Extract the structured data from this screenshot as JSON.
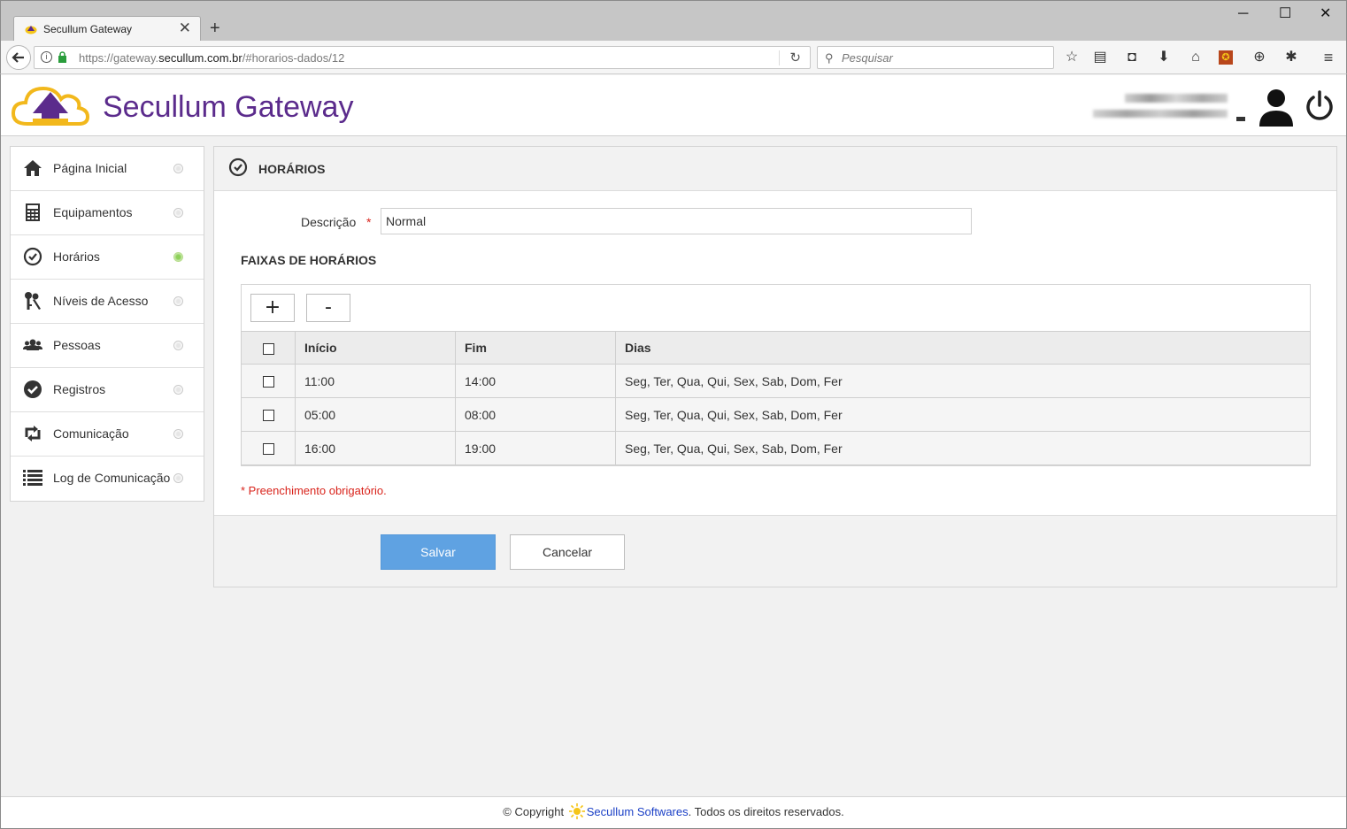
{
  "browser": {
    "tab_title": "Secullum Gateway",
    "tab_close": "✕",
    "new_tab": "+",
    "window_controls": {
      "minimize": "─",
      "maximize": "☐",
      "close": "✕"
    },
    "url_prefix": "https://gateway.",
    "url_domain": "secullum.com.br",
    "url_path": "/#horarios-dados/12",
    "search_placeholder": "Pesquisar",
    "toolbar_icons": [
      "star-icon",
      "reader-icon",
      "pocket-icon",
      "download-icon",
      "home-icon",
      "addon-icon",
      "globe-icon",
      "extension-icon",
      "menu-icon"
    ]
  },
  "header": {
    "brand": "Secullum Gateway",
    "brand_color": "#5b2b8c"
  },
  "sidebar": {
    "items": [
      {
        "label": "Página Inicial",
        "icon": "home-icon",
        "active": false
      },
      {
        "label": "Equipamentos",
        "icon": "calculator-icon",
        "active": false
      },
      {
        "label": "Horários",
        "icon": "clock-icon",
        "active": true
      },
      {
        "label": "Níveis de Acesso",
        "icon": "keys-icon",
        "active": false
      },
      {
        "label": "Pessoas",
        "icon": "people-icon",
        "active": false
      },
      {
        "label": "Registros",
        "icon": "check-circle-icon",
        "active": false
      },
      {
        "label": "Comunicação",
        "icon": "retweet-icon",
        "active": false
      },
      {
        "label": "Log de Comunicação",
        "icon": "list-icon",
        "active": false
      }
    ]
  },
  "panel": {
    "title": "HORÁRIOS",
    "description_label": "Descrição",
    "required_mark": "*",
    "description_value": "Normal",
    "section_title": "FAIXAS DE HORÁRIOS",
    "add_label": "+",
    "remove_label": "-",
    "columns": [
      "Início",
      "Fim",
      "Dias"
    ],
    "rows": [
      {
        "inicio": "11:00",
        "fim": "14:00",
        "dias": "Seg, Ter, Qua, Qui, Sex, Sab, Dom, Fer"
      },
      {
        "inicio": "05:00",
        "fim": "08:00",
        "dias": "Seg, Ter, Qua, Qui, Sex, Sab, Dom, Fer"
      },
      {
        "inicio": "16:00",
        "fim": "19:00",
        "dias": "Seg, Ter, Qua, Qui, Sex, Sab, Dom, Fer"
      }
    ],
    "required_note": "* Preenchimento obrigatório.",
    "save_label": "Salvar",
    "cancel_label": "Cancelar"
  },
  "footer": {
    "copyright": "© Copyright",
    "company": "Secullum Softwares",
    "rights": ". Todos os direitos reservados."
  },
  "colors": {
    "accent_blue": "#5fa2e2",
    "required_red": "#d9241c",
    "active_green": "#8ed15a",
    "link_blue": "#1a3fc6"
  }
}
